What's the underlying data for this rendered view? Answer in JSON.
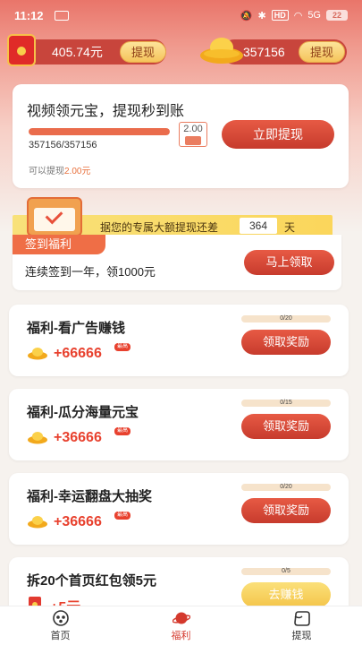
{
  "status_bar": {
    "time": "11:12",
    "hd": "HD",
    "signal": "5G",
    "battery": "22"
  },
  "header": {
    "balance": "405.74元",
    "balance_withdraw": "提现",
    "ingots": "357156",
    "ingots_withdraw": "提现"
  },
  "main_card": {
    "title": "视频领元宝，提现秒到账",
    "progress_text": "357156/357156",
    "progress_fraction": 1.0,
    "amount": "2.00",
    "hint_prefix": "可以提现",
    "hint_amount": "2.00元",
    "button": "立即提现"
  },
  "checkin": {
    "strip_text": "据您的专属大额提现还差",
    "days": "364",
    "days_unit": "天",
    "tag": "签到福利",
    "desc": "连续签到一年，领1000元",
    "button": "马上领取"
  },
  "tasks": [
    {
      "title": "福利-看广告赚钱",
      "reward": "+66666",
      "badge": "最高",
      "progress": "0/20",
      "button": "领取奖励"
    },
    {
      "title": "福利-瓜分海量元宝",
      "reward": "+36666",
      "badge": "最高",
      "progress": "0/15",
      "button": "领取奖励"
    },
    {
      "title": "福利-幸运翻盘大抽奖",
      "reward": "+36666",
      "badge": "最高",
      "progress": "0/20",
      "button": "领取奖励"
    },
    {
      "title": "拆20个首页红包领5元",
      "reward": "+5元",
      "progress": "0/5",
      "button": "去赚钱"
    }
  ],
  "nav": [
    {
      "label": "首页",
      "icon": "home-icon"
    },
    {
      "label": "福利",
      "icon": "welfare-planet-icon"
    },
    {
      "label": "提现",
      "icon": "withdraw-wallet-icon"
    }
  ],
  "colors": {
    "accent": "#d4392d",
    "gold": "#f4c54a"
  }
}
